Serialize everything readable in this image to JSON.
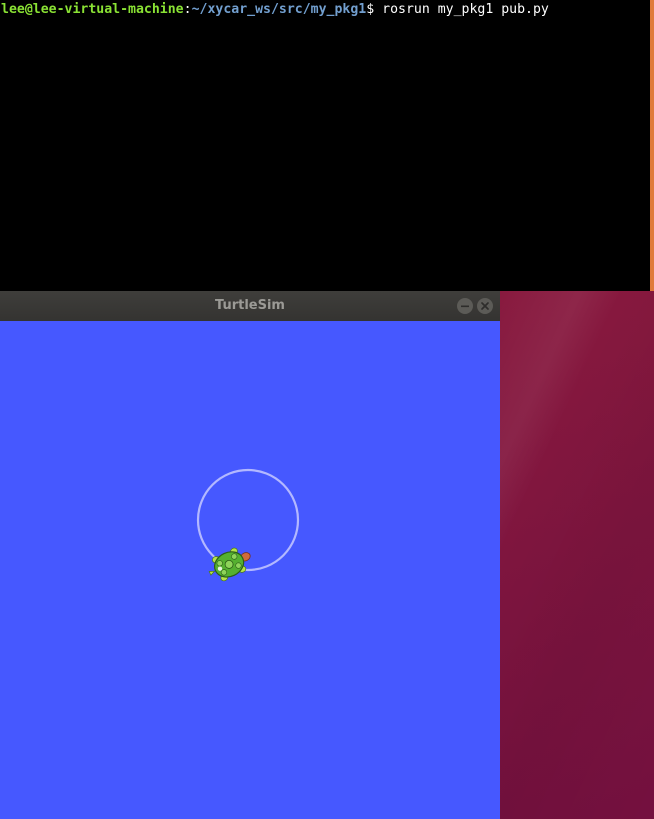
{
  "terminal": {
    "prompt_user": "lee@lee-virtual-machine",
    "prompt_colon": ":",
    "prompt_path": "~/xycar_ws/src/my_pkg1",
    "prompt_dollar": "$",
    "command": " rosrun my_pkg1 pub.py"
  },
  "turtlesim": {
    "title": "TurtleSim",
    "background_color": "#4658ff",
    "trail_color": "#b3b8ff",
    "turtle_shell_color": "#55b030",
    "turtle_skin_color": "#b6e24a"
  },
  "colors": {
    "terminal_bg": "#000000",
    "prompt_user": "#8ae234",
    "prompt_path": "#729fcf",
    "titlebar_bg": "#3c3b37"
  }
}
